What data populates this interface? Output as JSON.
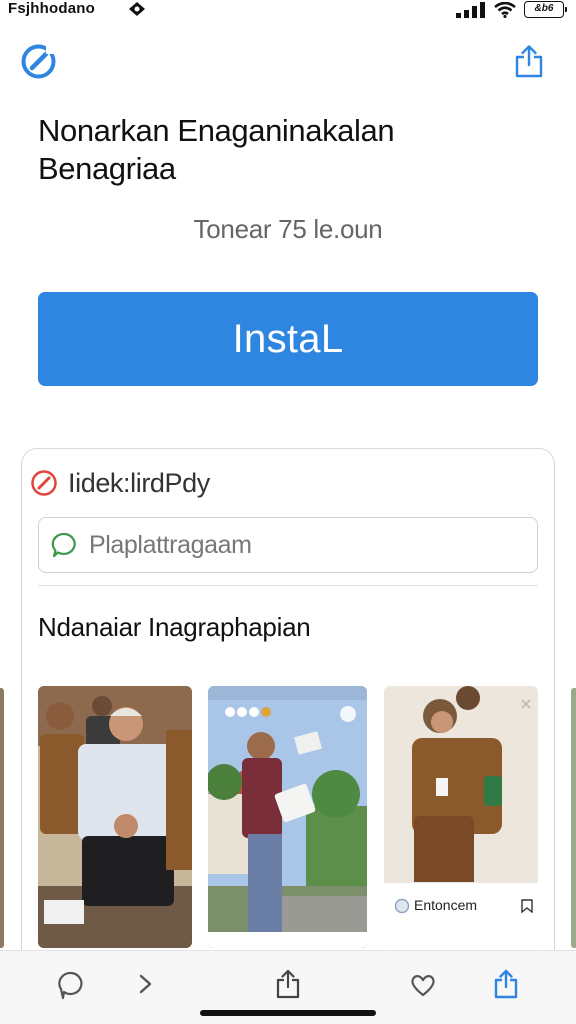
{
  "status_bar": {
    "carrier": "Fsjhhodano",
    "battery": "&b6"
  },
  "header": {
    "logo_icon": "gauge-logo-icon",
    "share_icon": "share-icon"
  },
  "app": {
    "title": "Nonarkan Enaganinakalan Benagriaa",
    "subtitle": "Tonear 75 le.oun",
    "install_label": "InstaL"
  },
  "card": {
    "row_label": "Iidek:lirdPdy",
    "field_text": "Plaplattragaam",
    "section_title": "Ndanaiar Inagraphapian",
    "screenshot_caption": "Entoncem"
  },
  "colors": {
    "accent": "#2f86e0",
    "background": "#ffffff",
    "toolbar": "#f7f7f7"
  },
  "toolbar": {
    "items": [
      "chat-bubble-icon",
      "chevron-right-icon",
      "share-icon",
      "heart-icon",
      "share-icon"
    ]
  }
}
